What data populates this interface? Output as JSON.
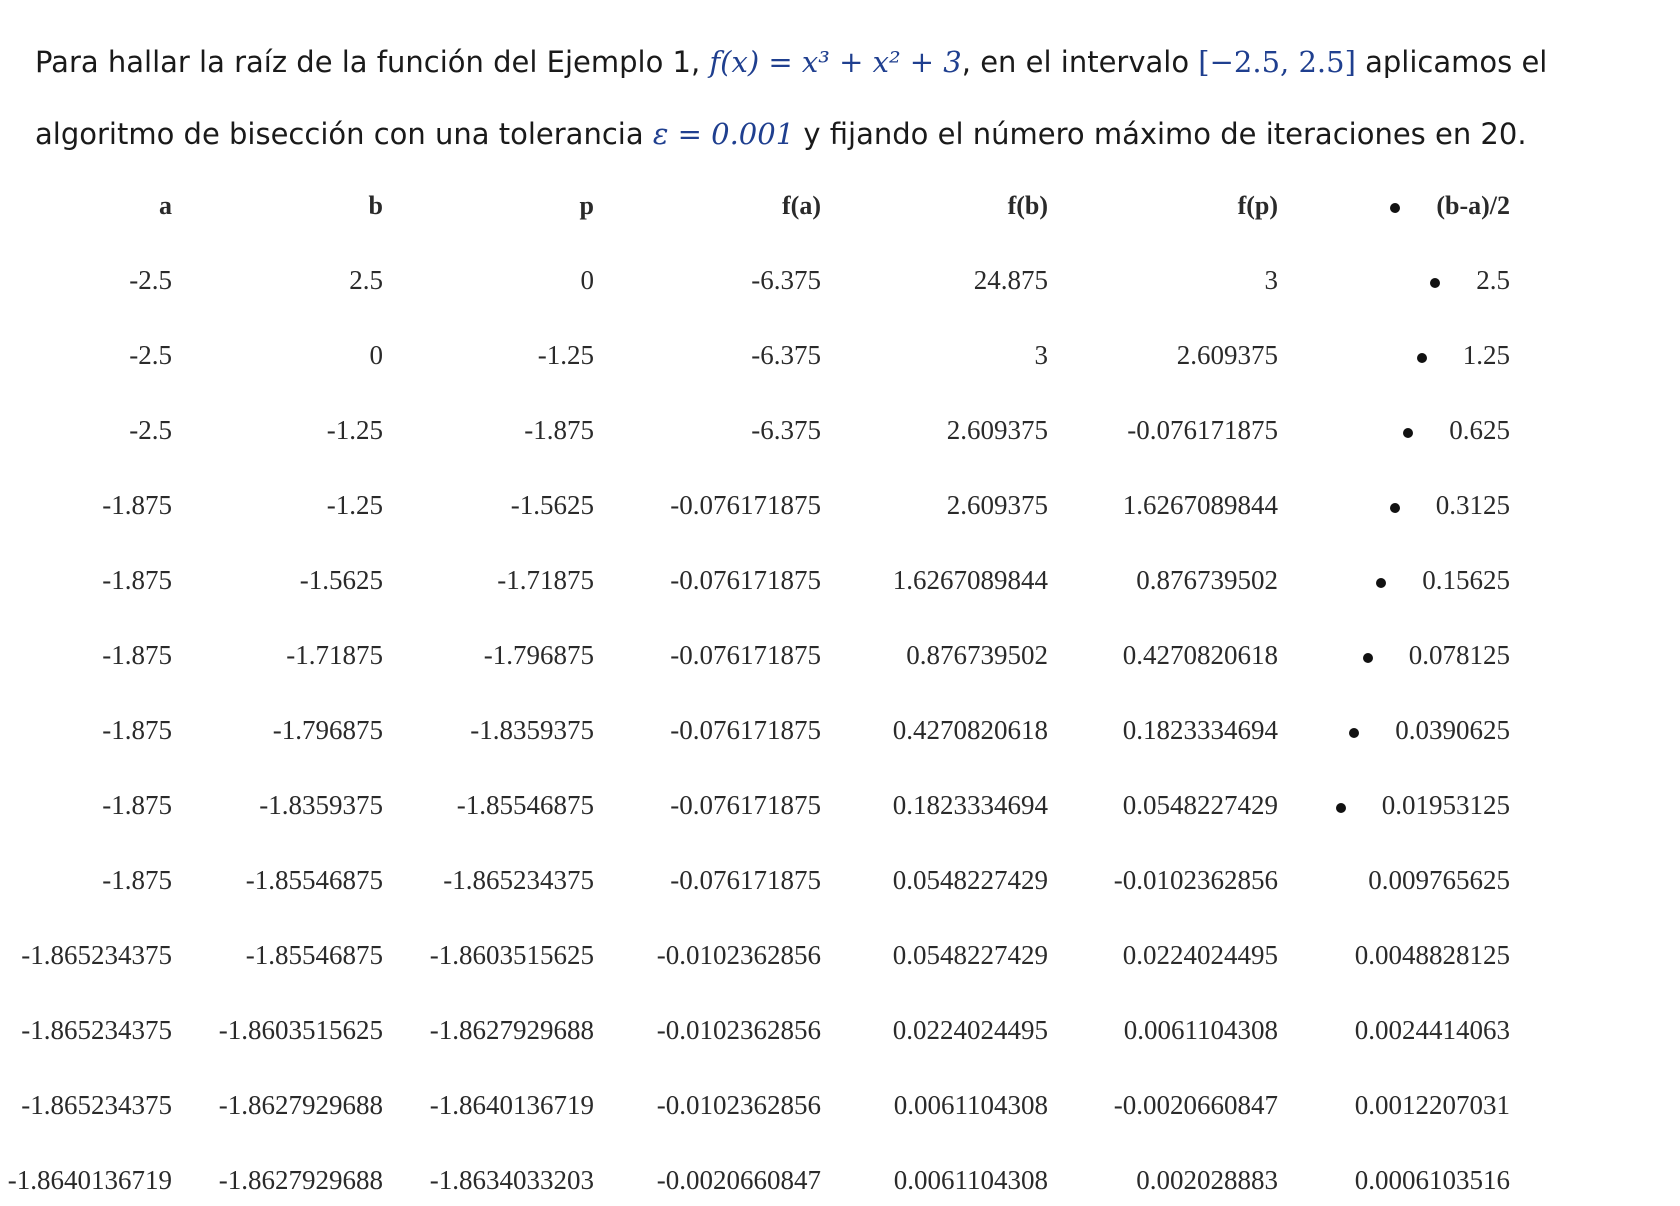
{
  "intro": {
    "t1": "Para hallar la raíz de la función del Ejemplo 1, ",
    "func": "f(x) = x³ + x² + 3",
    "t2": ", en el intervalo ",
    "interval": "[−2.5, 2.5]",
    "t3": " aplicamos el algoritmo de bisección con una tolerancia ",
    "tol": "ε = 0.001",
    "t4": " y fijando el número máximo de iteraciones en 20."
  },
  "table": {
    "headers": [
      "a",
      "b",
      "p",
      "f(a)",
      "f(b)",
      "f(p)",
      "(b-a)/2"
    ],
    "rows": [
      [
        "-2.5",
        "2.5",
        "0",
        "-6.375",
        "24.875",
        "3",
        "2.5"
      ],
      [
        "-2.5",
        "0",
        "-1.25",
        "-6.375",
        "3",
        "2.609375",
        "1.25"
      ],
      [
        "-2.5",
        "-1.25",
        "-1.875",
        "-6.375",
        "2.609375",
        "-0.076171875",
        "0.625"
      ],
      [
        "-1.875",
        "-1.25",
        "-1.5625",
        "-0.076171875",
        "2.609375",
        "1.6267089844",
        "0.3125"
      ],
      [
        "-1.875",
        "-1.5625",
        "-1.71875",
        "-0.076171875",
        "1.6267089844",
        "0.876739502",
        "0.15625"
      ],
      [
        "-1.875",
        "-1.71875",
        "-1.796875",
        "-0.076171875",
        "0.876739502",
        "0.4270820618",
        "0.078125"
      ],
      [
        "-1.875",
        "-1.796875",
        "-1.8359375",
        "-0.076171875",
        "0.4270820618",
        "0.1823334694",
        "0.0390625"
      ],
      [
        "-1.875",
        "-1.8359375",
        "-1.85546875",
        "-0.076171875",
        "0.1823334694",
        "0.0548227429",
        "0.01953125"
      ],
      [
        "-1.875",
        "-1.85546875",
        "-1.865234375",
        "-0.076171875",
        "0.0548227429",
        "-0.0102362856",
        "0.009765625"
      ],
      [
        "-1.865234375",
        "-1.85546875",
        "-1.8603515625",
        "-0.0102362856",
        "0.0548227429",
        "0.0224024495",
        "0.0048828125"
      ],
      [
        "-1.865234375",
        "-1.8603515625",
        "-1.8627929688",
        "-0.0102362856",
        "0.0224024495",
        "0.0061104308",
        "0.0024414063"
      ],
      [
        "-1.865234375",
        "-1.8627929688",
        "-1.8640136719",
        "-0.0102362856",
        "0.0061104308",
        "-0.0020660847",
        "0.0012207031"
      ],
      [
        "-1.8640136719",
        "-1.8627929688",
        "-1.8634033203",
        "-0.0020660847",
        "0.0061104308",
        "0.002028883",
        "0.0006103516"
      ]
    ]
  }
}
